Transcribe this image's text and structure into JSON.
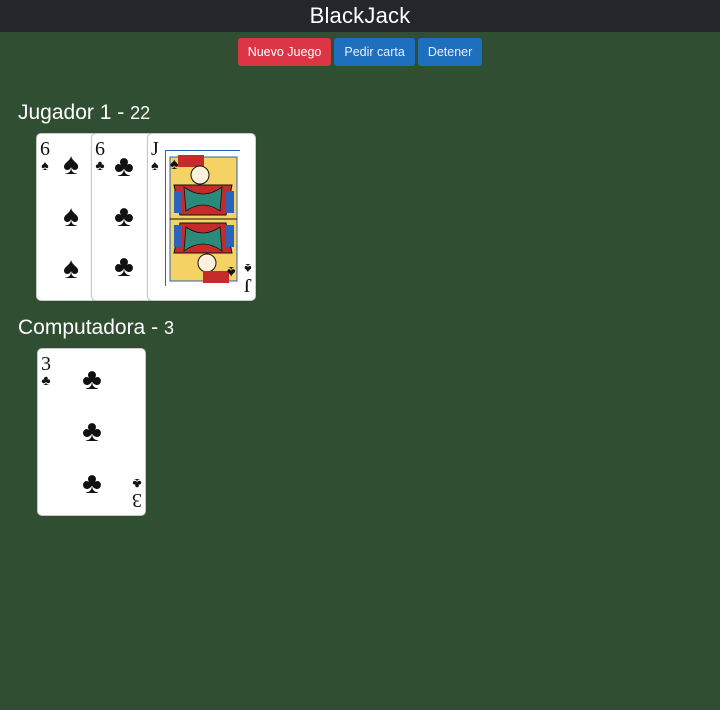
{
  "app": {
    "title": "BlackJack"
  },
  "controls": {
    "new_game": "Nuevo Juego",
    "hit": "Pedir carta",
    "stand": "Detener"
  },
  "players": [
    {
      "name": "Jugador 1",
      "separator": "-",
      "score": "22",
      "cards": [
        {
          "rank": "6",
          "suit": "♠",
          "suit_name": "spades"
        },
        {
          "rank": "6",
          "suit": "♣",
          "suit_name": "clubs"
        },
        {
          "rank": "J",
          "suit": "♠",
          "suit_name": "spades"
        }
      ]
    },
    {
      "name": "Computadora",
      "separator": "-",
      "score": "3",
      "cards": [
        {
          "rank": "3",
          "suit": "♣",
          "suit_name": "clubs"
        }
      ]
    }
  ],
  "colors": {
    "table_green": "#304f32",
    "header_dark": "#23262b",
    "danger_red": "#dc3545",
    "primary_blue": "#1f6fbf",
    "card_white": "#ffffff"
  }
}
